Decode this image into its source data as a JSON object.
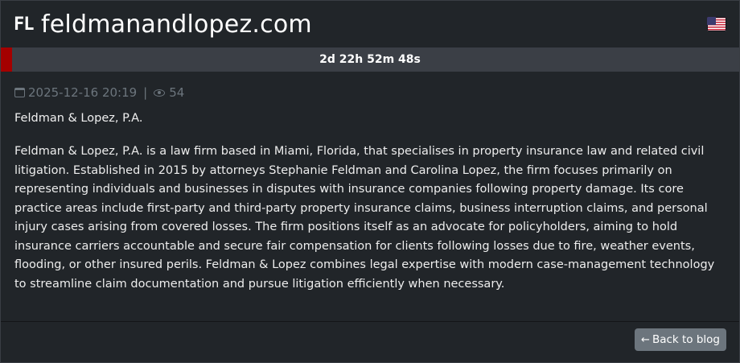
{
  "header": {
    "logo_text": "FL",
    "site_title": "feldmanandlopez.com",
    "flag_icon": "us-flag-icon"
  },
  "countdown": {
    "text": "2d 22h 52m 48s",
    "progress_fraction": 0.015,
    "progress_color": "#a40000"
  },
  "meta": {
    "calendar_icon": "calendar-icon",
    "date": "2025-12-16 20:19",
    "separator": "|",
    "eye_icon": "eye-icon",
    "views": "54"
  },
  "post": {
    "company_name": "Feldman & Lopez, P.A.",
    "description": "Feldman & Lopez, P.A. is a law firm based in Miami, Florida, that specialises in property insurance law and related civil litigation. Established in 2015 by attorneys Stephanie Feldman and Carolina Lopez, the firm focuses primarily on representing individuals and businesses in disputes with insurance companies following property damage. Its core practice areas include first-party and third-party property insurance claims, business interruption claims, and personal injury cases arising from covered losses. The firm positions itself as an advocate for policyholders, aiming to hold insurance carriers accountable and secure fair compensation for clients following losses due to fire, weather events, flooding, or other insured perils. Feldman & Lopez combines legal expertise with modern case-management technology to streamline claim documentation and pursue litigation efficiently when necessary."
  },
  "footer": {
    "back_label": "Back to blog",
    "back_icon": "left-arrow-icon"
  }
}
